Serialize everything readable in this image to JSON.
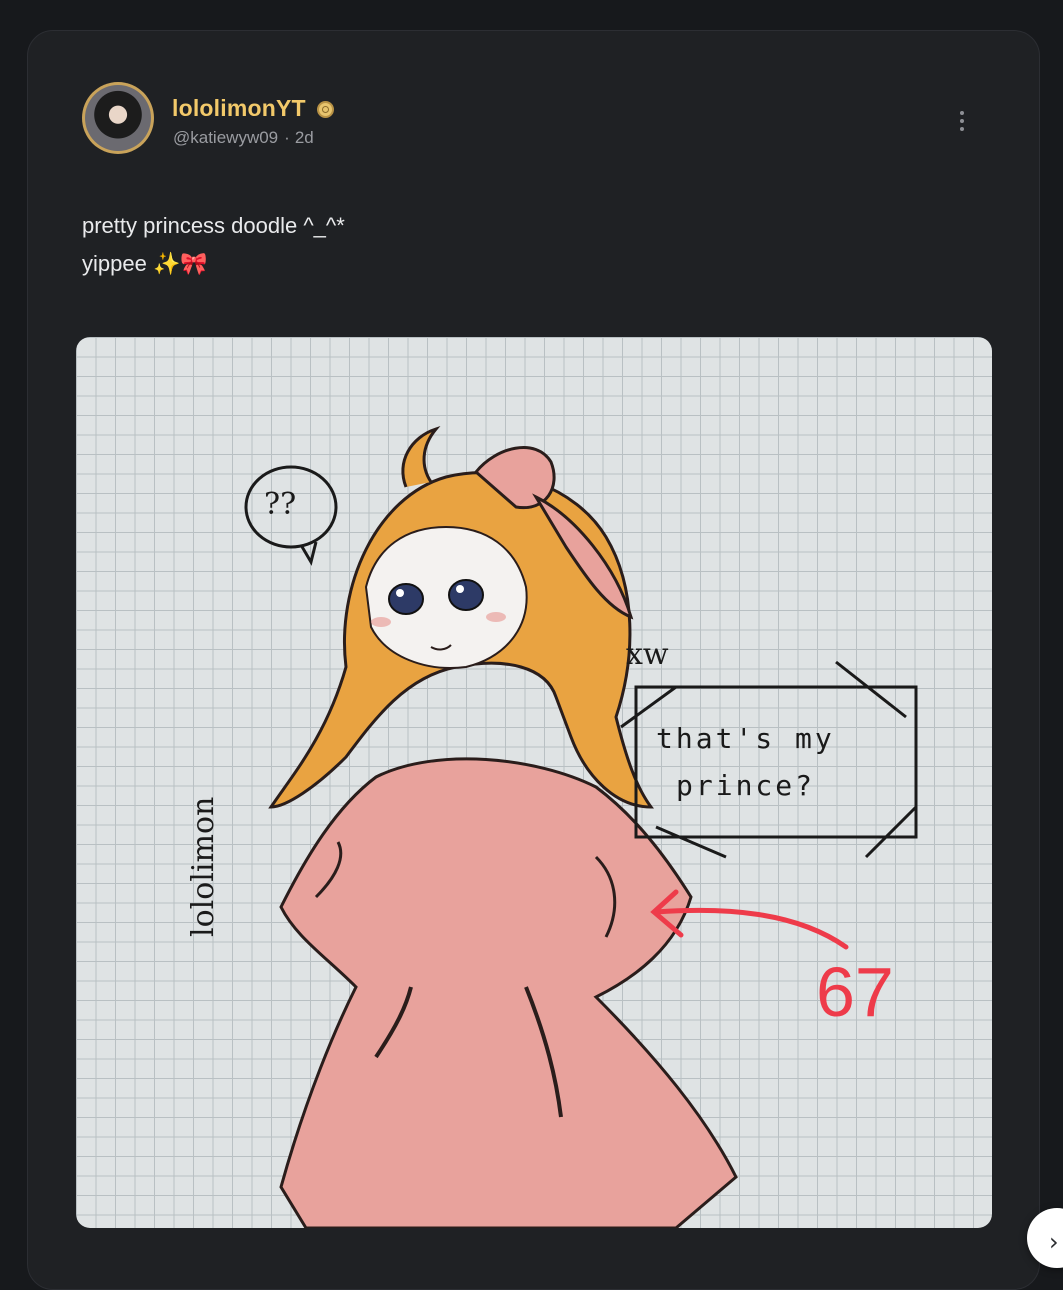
{
  "post": {
    "author": {
      "display_name": "lololimonYT",
      "handle": "@katiewyw09",
      "time_ago": "2d",
      "meta_separator": "·",
      "badge_icon": "verified-badge-icon"
    },
    "text_lines": [
      "pretty princess doodle ^_^*",
      "yippee ✨🎀"
    ],
    "more_options_icon": "vertical-ellipsis-icon"
  },
  "image": {
    "speech_bubble_text": "??",
    "sign_text_line1": "that's my",
    "sign_text_line2": "prince?",
    "annotation_number": "67",
    "signature_text": "lololimon",
    "side_word": "xw"
  },
  "navigation": {
    "next_icon": "chevron-right-icon",
    "next_glyph": "›"
  },
  "colors": {
    "background": "#17191c",
    "card": "#1f2124",
    "username": "#f2c96a",
    "handle": "#9a9ca1",
    "text": "#e9eaec",
    "annotation_red": "#ee3b4a",
    "dress_pink": "#e8a29c",
    "hair_orange": "#e9a341"
  }
}
